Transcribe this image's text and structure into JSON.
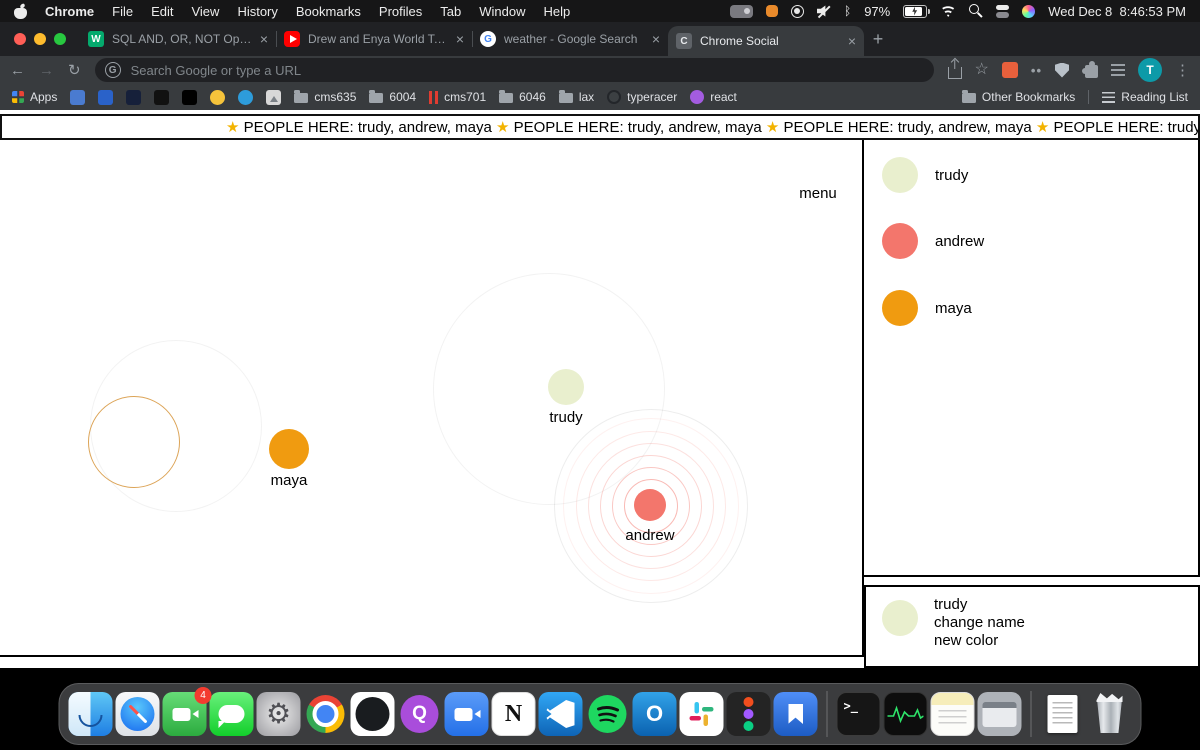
{
  "menubar": {
    "app_name": "Chrome",
    "menus": [
      "File",
      "Edit",
      "View",
      "History",
      "Bookmarks",
      "Profiles",
      "Tab",
      "Window",
      "Help"
    ],
    "battery_percent": "97%",
    "clock": "Wed Dec 8  8:46:53 PM"
  },
  "browser": {
    "tabs": [
      {
        "title": "SQL AND, OR, NOT Operators",
        "icon": "w3schools",
        "fav_letter": "W"
      },
      {
        "title": "Drew and Enya World Tour Ext",
        "icon": "youtube",
        "fav_letter": ""
      },
      {
        "title": "weather - Google Search",
        "icon": "google",
        "fav_letter": "G"
      },
      {
        "title": "Chrome Social",
        "icon": "site",
        "fav_letter": "C"
      }
    ],
    "close_glyph": "×",
    "new_tab_glyph": "+",
    "toolbar": {
      "back_glyph": "←",
      "forward_glyph": "→",
      "reload_glyph": "↻",
      "omnibox_icon_letter": "G",
      "omnibox_placeholder": "Search Google or type a URL",
      "star_glyph": "☆",
      "more_dots": "••",
      "avatar_letter": "T",
      "kebab_glyph": "⋮"
    },
    "bookmarks_bar": {
      "apps_label": "Apps",
      "items": [
        "cms635",
        "6004",
        "cms701",
        "6046",
        "lax",
        "typeracer",
        "react"
      ],
      "other_bookmarks": "Other Bookmarks",
      "reading_list": "Reading List"
    }
  },
  "page": {
    "marquee": {
      "star": "★",
      "segment": " PEOPLE HERE: trudy, andrew, maya "
    },
    "menu_label": "menu",
    "people": [
      {
        "name": "trudy",
        "color": "#e9efce"
      },
      {
        "name": "andrew",
        "color": "#f3766c"
      },
      {
        "name": "maya",
        "color": "#f09b10"
      }
    ],
    "user_menu": {
      "name": "trudy",
      "options": [
        "change name",
        "new color"
      ]
    }
  },
  "dock": {
    "badge_count": "4",
    "glyphs": {
      "q": "Q",
      "notion": "N",
      "outlook": "O",
      "terminal": ">_"
    },
    "apps": [
      "finder",
      "safari",
      "video-app",
      "messages",
      "system-preferences",
      "chrome",
      "github",
      "q-app",
      "zoom",
      "notion",
      "vscode",
      "spotify",
      "outlook",
      "slack",
      "figma",
      "bookmarks-app",
      "terminal",
      "activity-monitor",
      "stickies",
      "window-preview",
      "document",
      "trash"
    ]
  }
}
